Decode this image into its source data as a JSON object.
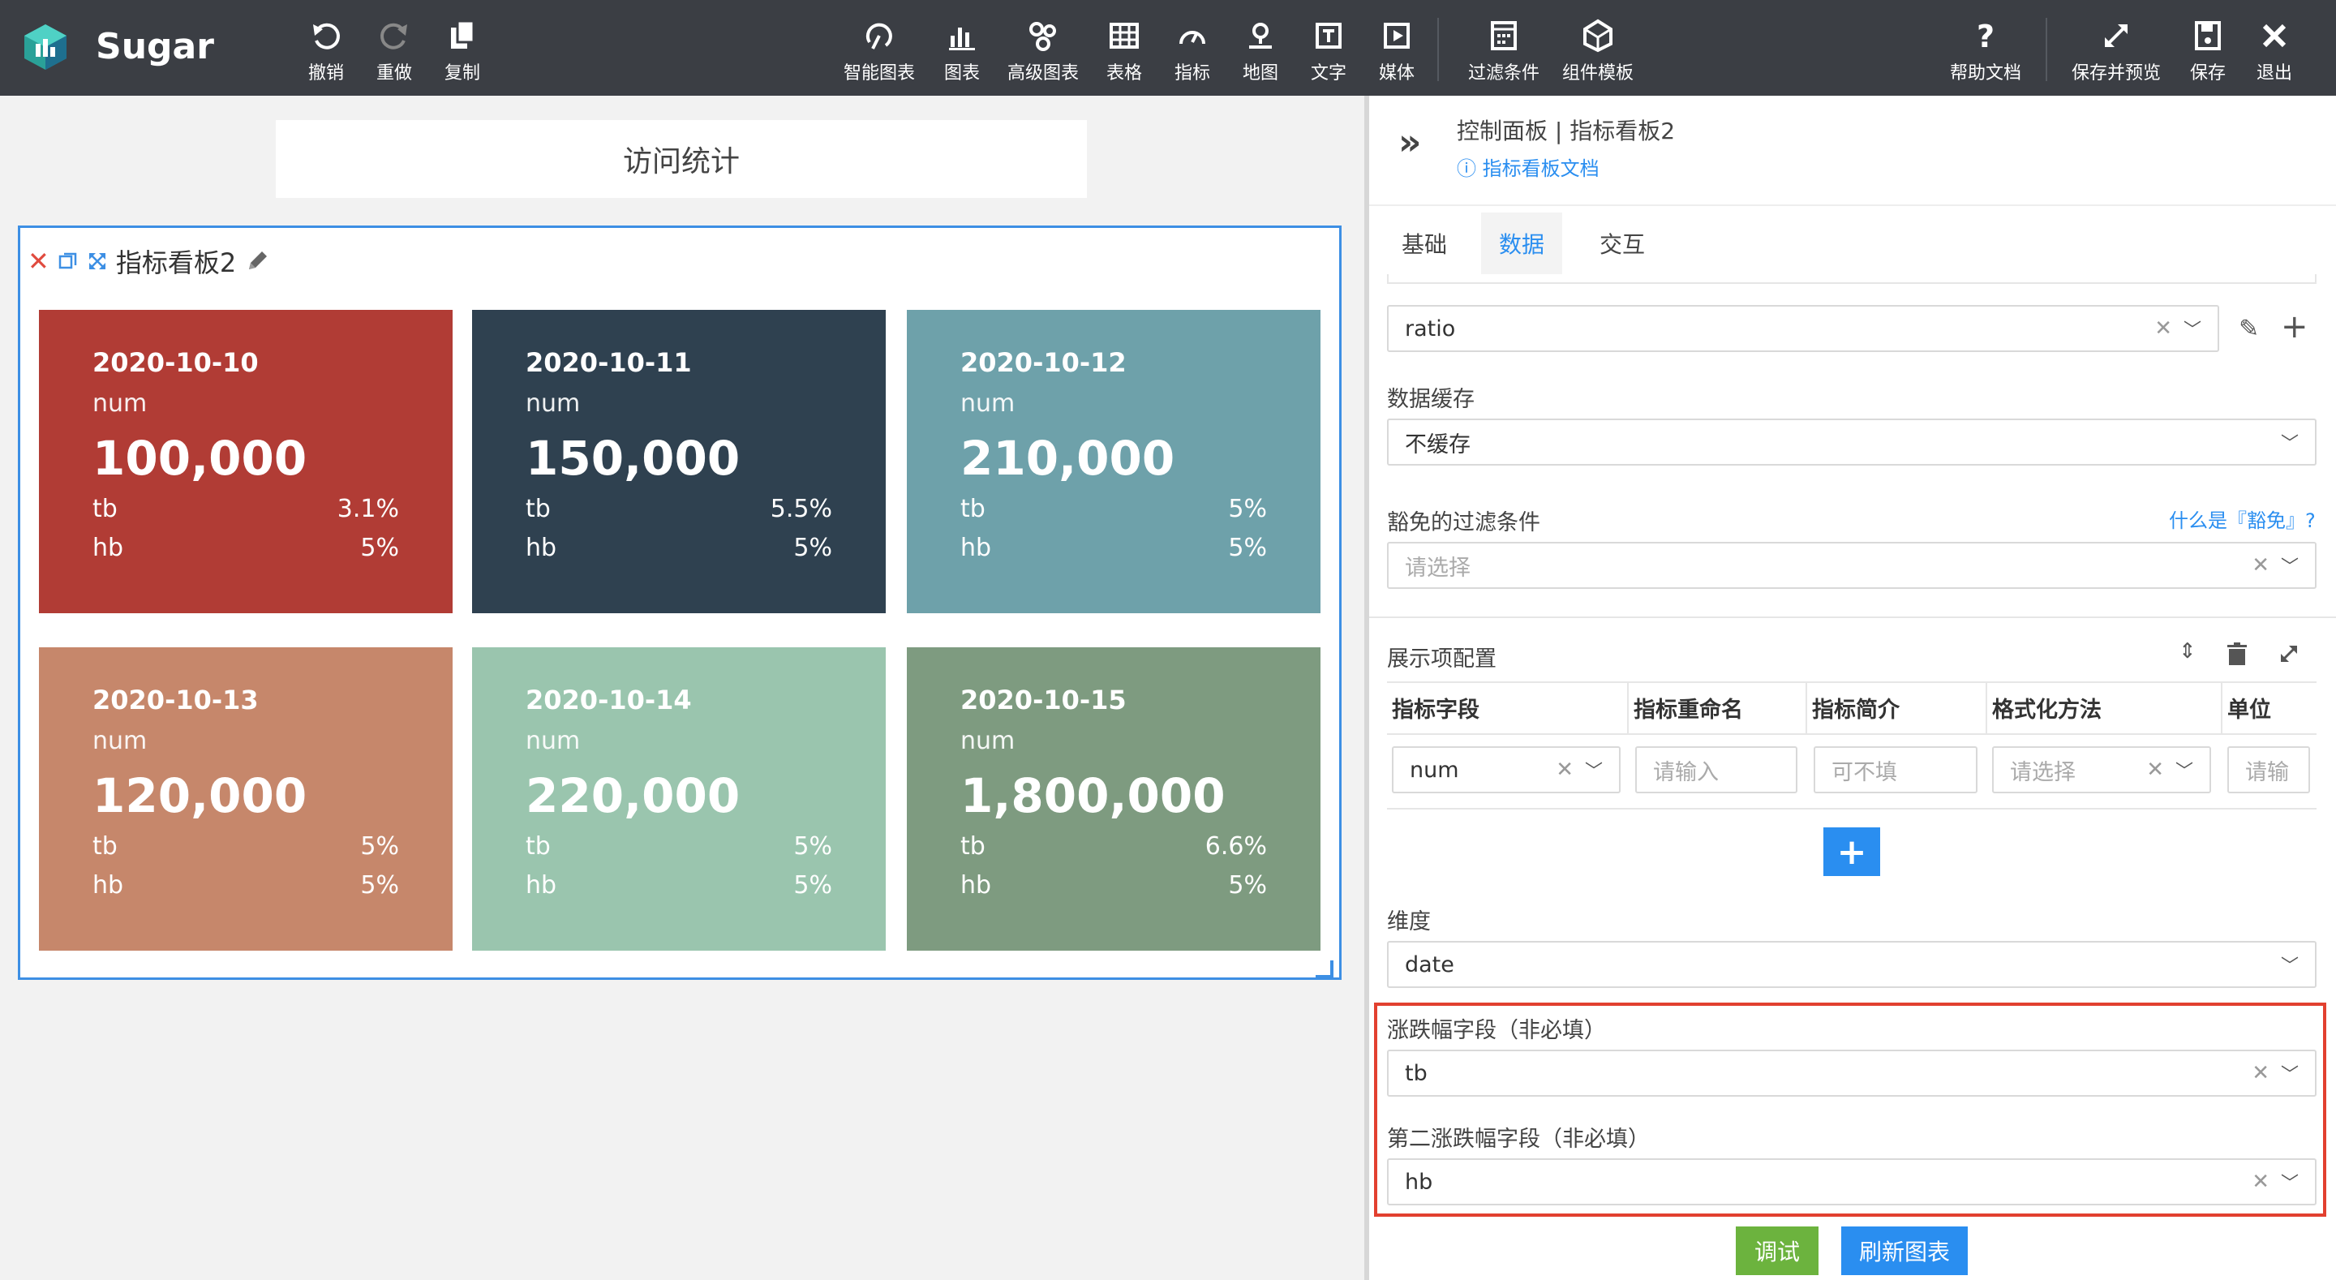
{
  "app": {
    "name": "Sugar"
  },
  "toolbar": {
    "left": [
      {
        "label": "撤销",
        "icon": "undo-icon"
      },
      {
        "label": "重做",
        "icon": "redo-icon"
      },
      {
        "label": "复制",
        "icon": "copy-icon"
      }
    ],
    "center": [
      {
        "label": "智能图表",
        "icon": "smart-chart-icon"
      },
      {
        "label": "图表",
        "icon": "bar-chart-icon"
      },
      {
        "label": "高级图表",
        "icon": "advanced-chart-icon"
      },
      {
        "label": "表格",
        "icon": "table-icon"
      },
      {
        "label": "指标",
        "icon": "gauge-icon"
      },
      {
        "label": "地图",
        "icon": "map-pin-icon"
      },
      {
        "label": "文字",
        "icon": "text-icon"
      },
      {
        "label": "媒体",
        "icon": "media-icon"
      },
      {
        "label": "过滤条件",
        "icon": "filter-icon"
      },
      {
        "label": "组件模板",
        "icon": "template-icon"
      }
    ],
    "right": [
      {
        "label": "帮助文档",
        "icon": "help-icon"
      },
      {
        "label": "保存并预览",
        "icon": "expand-icon"
      },
      {
        "label": "保存",
        "icon": "save-icon"
      },
      {
        "label": "退出",
        "icon": "close-icon"
      }
    ]
  },
  "canvas": {
    "title": "访问统计",
    "widget": {
      "name": "指标看板2",
      "cards": [
        {
          "date": "2020-10-10",
          "metric": "num",
          "value": "100,000",
          "tb_label": "tb",
          "tb": "3.1%",
          "hb_label": "hb",
          "hb": "5%",
          "color": "#b13c35"
        },
        {
          "date": "2020-10-11",
          "metric": "num",
          "value": "150,000",
          "tb_label": "tb",
          "tb": "5.5%",
          "hb_label": "hb",
          "hb": "5%",
          "color": "#2f4150"
        },
        {
          "date": "2020-10-12",
          "metric": "num",
          "value": "210,000",
          "tb_label": "tb",
          "tb": "5%",
          "hb_label": "hb",
          "hb": "5%",
          "color": "#6ea1aa"
        },
        {
          "date": "2020-10-13",
          "metric": "num",
          "value": "120,000",
          "tb_label": "tb",
          "tb": "5%",
          "hb_label": "hb",
          "hb": "5%",
          "color": "#c6876b"
        },
        {
          "date": "2020-10-14",
          "metric": "num",
          "value": "220,000",
          "tb_label": "tb",
          "tb": "5%",
          "hb_label": "hb",
          "hb": "5%",
          "color": "#9ac5ae"
        },
        {
          "date": "2020-10-15",
          "metric": "num",
          "value": "1,800,000",
          "tb_label": "tb",
          "tb": "6.6%",
          "hb_label": "hb",
          "hb": "5%",
          "color": "#7e9b80"
        }
      ]
    }
  },
  "panel": {
    "title": "控制面板 | 指标看板2",
    "doc_link": "指标看板文档",
    "tabs": [
      {
        "label": "基础",
        "active": false
      },
      {
        "label": "数据",
        "active": true
      },
      {
        "label": "交互",
        "active": false
      }
    ],
    "source_value": "ratio",
    "cache": {
      "label": "数据缓存",
      "value": "不缓存"
    },
    "exempt": {
      "label": "豁免的过滤条件",
      "help": "什么是『豁免』?",
      "placeholder": "请选择"
    },
    "display": {
      "label": "展示项配置",
      "columns": [
        "指标字段",
        "指标重命名",
        "指标简介",
        "格式化方法",
        "单位"
      ],
      "row": {
        "field": "num",
        "rename_ph": "请输入",
        "intro_ph": "可不填",
        "format_ph": "请选择",
        "unit_ph": "请输"
      }
    },
    "dimension": {
      "label": "维度",
      "value": "date"
    },
    "change_field": {
      "label": "涨跌幅字段（非必填）",
      "value": "tb"
    },
    "second_change_field": {
      "label": "第二涨跌幅字段（非必填）",
      "value": "hb"
    },
    "buttons": {
      "debug": "调试",
      "refresh": "刷新图表"
    },
    "colors": {
      "accent": "#2a8ef0",
      "debug": "#6cb33e",
      "highlight": "#e2402f"
    }
  }
}
